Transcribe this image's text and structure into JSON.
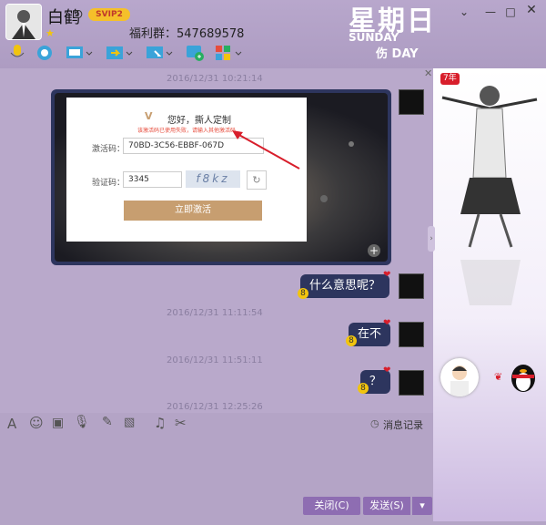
{
  "title_bar": {
    "name": "白鹤",
    "svip": "SVIP2",
    "group_text": "福利群：547689578",
    "brand_day": "星期日",
    "brand_sunday": "SUNDAY",
    "brand_day2": "伤 DAY"
  },
  "messages": {
    "ts1": "2016/12/31 10:21:14",
    "ts2": "2016/12/31 11:11:54",
    "ts3": "2016/12/31 11:51:11",
    "ts4": "2016/12/31 12:25:26",
    "msg1": "什么意思呢？",
    "msg2": "在不",
    "msg3": "？",
    "vip_small": "8"
  },
  "activation_dialog": {
    "title": "您好，撕人定制",
    "warning": "该激活码已使用失败，请输入其他激活码",
    "code_label": "激活码：",
    "code_value": "70BD-3C56-EBBF-067D",
    "captcha_label": "验证码：",
    "captcha_value": "3345",
    "captcha_image": "f8kz",
    "activate_button": "立即激活"
  },
  "input_toolbar": {
    "history": "消息记录"
  },
  "buttons": {
    "close": "关闭(C)",
    "send": "发送(S)"
  },
  "sidebar": {
    "badge": "7年"
  },
  "colors": {
    "accent": "#8e6db2",
    "bubble": "#2d355e",
    "panel": "#b9a9cb"
  }
}
